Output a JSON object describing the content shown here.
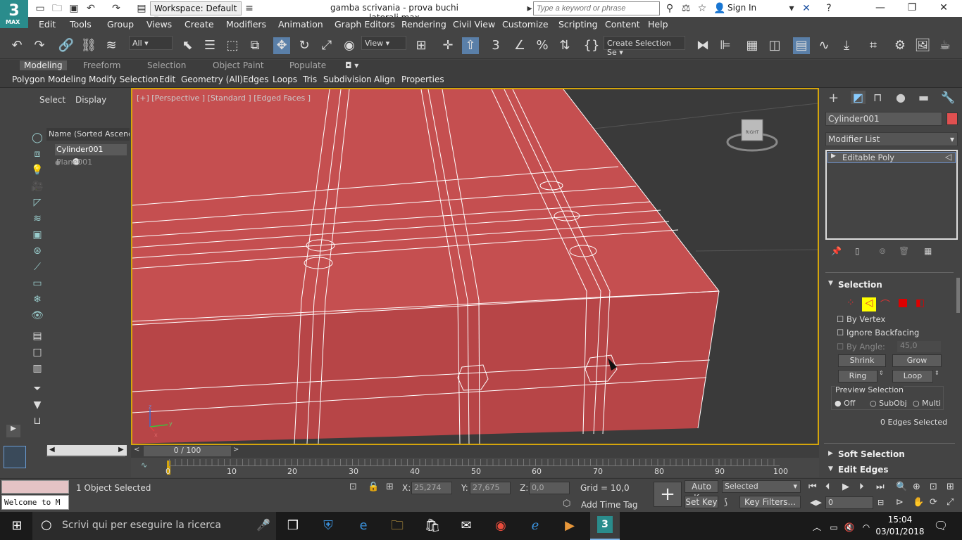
{
  "app": {
    "logo_text": "3",
    "logo_sub": "MAX",
    "workspace": "Workspace: Default",
    "doc_title": "gamba scrivania - prova buchi laterali.max",
    "search_placeholder": "Type a keyword or phrase",
    "signin": "Sign In"
  },
  "menu": [
    "Edit",
    "Tools",
    "Group",
    "Views",
    "Create",
    "Modifiers",
    "Animation",
    "Graph Editors",
    "Rendering",
    "Civil View",
    "Customize",
    "Scripting",
    "Content",
    "Help"
  ],
  "toolbar": {
    "filter_select": "All",
    "coord_select": "View",
    "selection_set": "Create Selection Se"
  },
  "ribbon": {
    "tabs": [
      "Modeling",
      "Freeform",
      "Selection",
      "Object Paint",
      "Populate"
    ],
    "active": "Modeling",
    "subtabs": [
      "Polygon Modeling",
      "Modify Selection",
      "Edit",
      "Geometry (All)",
      "Edges",
      "Loops",
      "Tris",
      "Subdivision",
      "Align",
      "Properties"
    ]
  },
  "scene_explorer": {
    "tabs": [
      "Select",
      "Display"
    ],
    "header": "Name (Sorted Ascendin",
    "objects": [
      {
        "name": "Cylinder001",
        "selected": true
      },
      {
        "name": "Plane001",
        "selected": false
      }
    ]
  },
  "viewport": {
    "label": "[+] [Perspective ] [Standard ] [Edged Faces ]",
    "viewcube_face": "RIGHT",
    "fill_color": "#c54f50",
    "axis_labels": [
      "z",
      "y",
      "x"
    ]
  },
  "timeline": {
    "frame": "0 / 100",
    "ticks": [
      "0",
      "10",
      "20",
      "30",
      "40",
      "50",
      "60",
      "70",
      "80",
      "90",
      "100"
    ]
  },
  "command_panel": {
    "object_name": "Cylinder001",
    "object_color": "#e05050",
    "modifier_list": "Modifier List",
    "stack": [
      "Editable Poly"
    ],
    "selection": {
      "title": "Selection",
      "by_vertex": "By Vertex",
      "ignore_backfacing": "Ignore Backfacing",
      "by_angle": "By Angle:",
      "angle_value": "45,0",
      "shrink": "Shrink",
      "grow": "Grow",
      "ring": "Ring",
      "loop": "Loop",
      "preview_title": "Preview Selection",
      "preview_off": "Off",
      "preview_subobj": "SubObj",
      "preview_multi": "Multi",
      "status": "0 Edges Selected"
    },
    "soft_selection": "Soft Selection",
    "edit_edges": "Edit Edges"
  },
  "status": {
    "maxscript": "Welcome to M",
    "selected": "1 Object Selected",
    "x_label": "X:",
    "x_value": "25,274",
    "y_label": "Y:",
    "y_value": "27,675",
    "z_label": "Z:",
    "z_value": "0,0",
    "grid": "Grid = 10,0",
    "add_time_tag": "Add Time Tag",
    "auto_key": "Auto Key",
    "set_key": "Set Key",
    "key_mode": "Selected",
    "key_filters": "Key Filters...",
    "frame_field": "0"
  },
  "taskbar": {
    "search_placeholder": "Scrivi qui per eseguire la ricerca",
    "time": "15:04",
    "date": "03/01/2018"
  }
}
